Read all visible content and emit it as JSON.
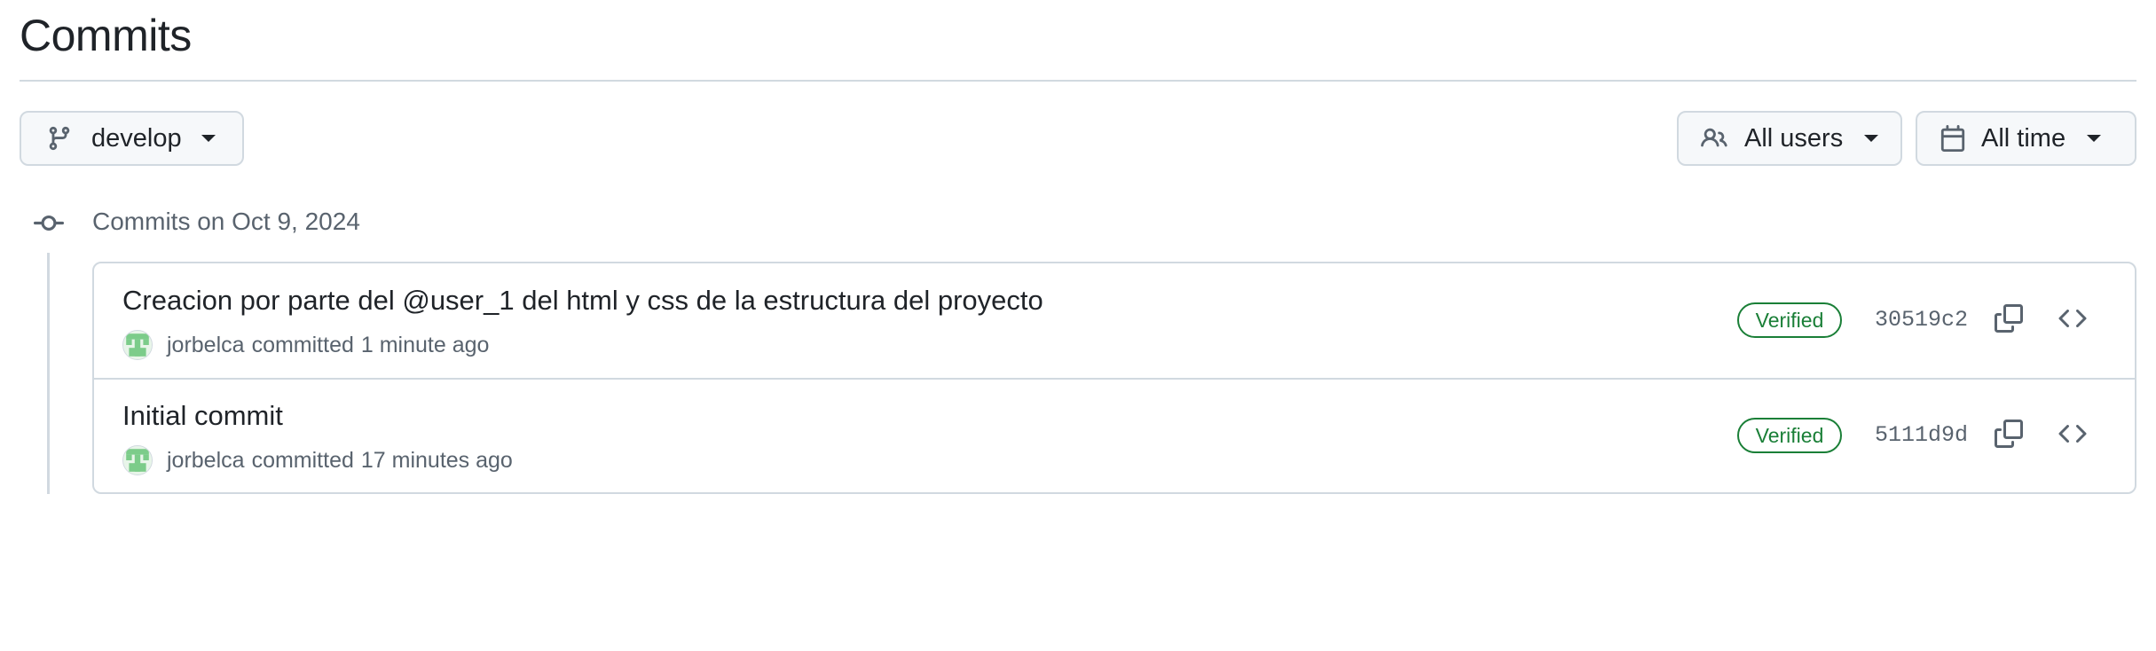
{
  "page": {
    "title": "Commits"
  },
  "filters": {
    "branch": {
      "label": "develop",
      "icon": "git-branch-icon"
    },
    "users": {
      "label": "All users",
      "icon": "people-icon"
    },
    "time": {
      "label": "All time",
      "icon": "calendar-icon"
    }
  },
  "timeline": {
    "date_heading": "Commits on Oct 9, 2024"
  },
  "commits": [
    {
      "message": "Creacion por parte del @user_1 del html y css de la estructura del proyecto",
      "author": "jorbelca",
      "action": "committed",
      "time": "1 minute ago",
      "badge": "Verified",
      "sha": "30519c2"
    },
    {
      "message": "Initial commit",
      "author": "jorbelca",
      "action": "committed",
      "time": "17 minutes ago",
      "badge": "Verified",
      "sha": "5111d9d"
    }
  ],
  "colors": {
    "verified": "#1a7f37",
    "border": "#d1d9e0",
    "muted_text": "#59636e",
    "button_bg": "#f6f8fa"
  }
}
